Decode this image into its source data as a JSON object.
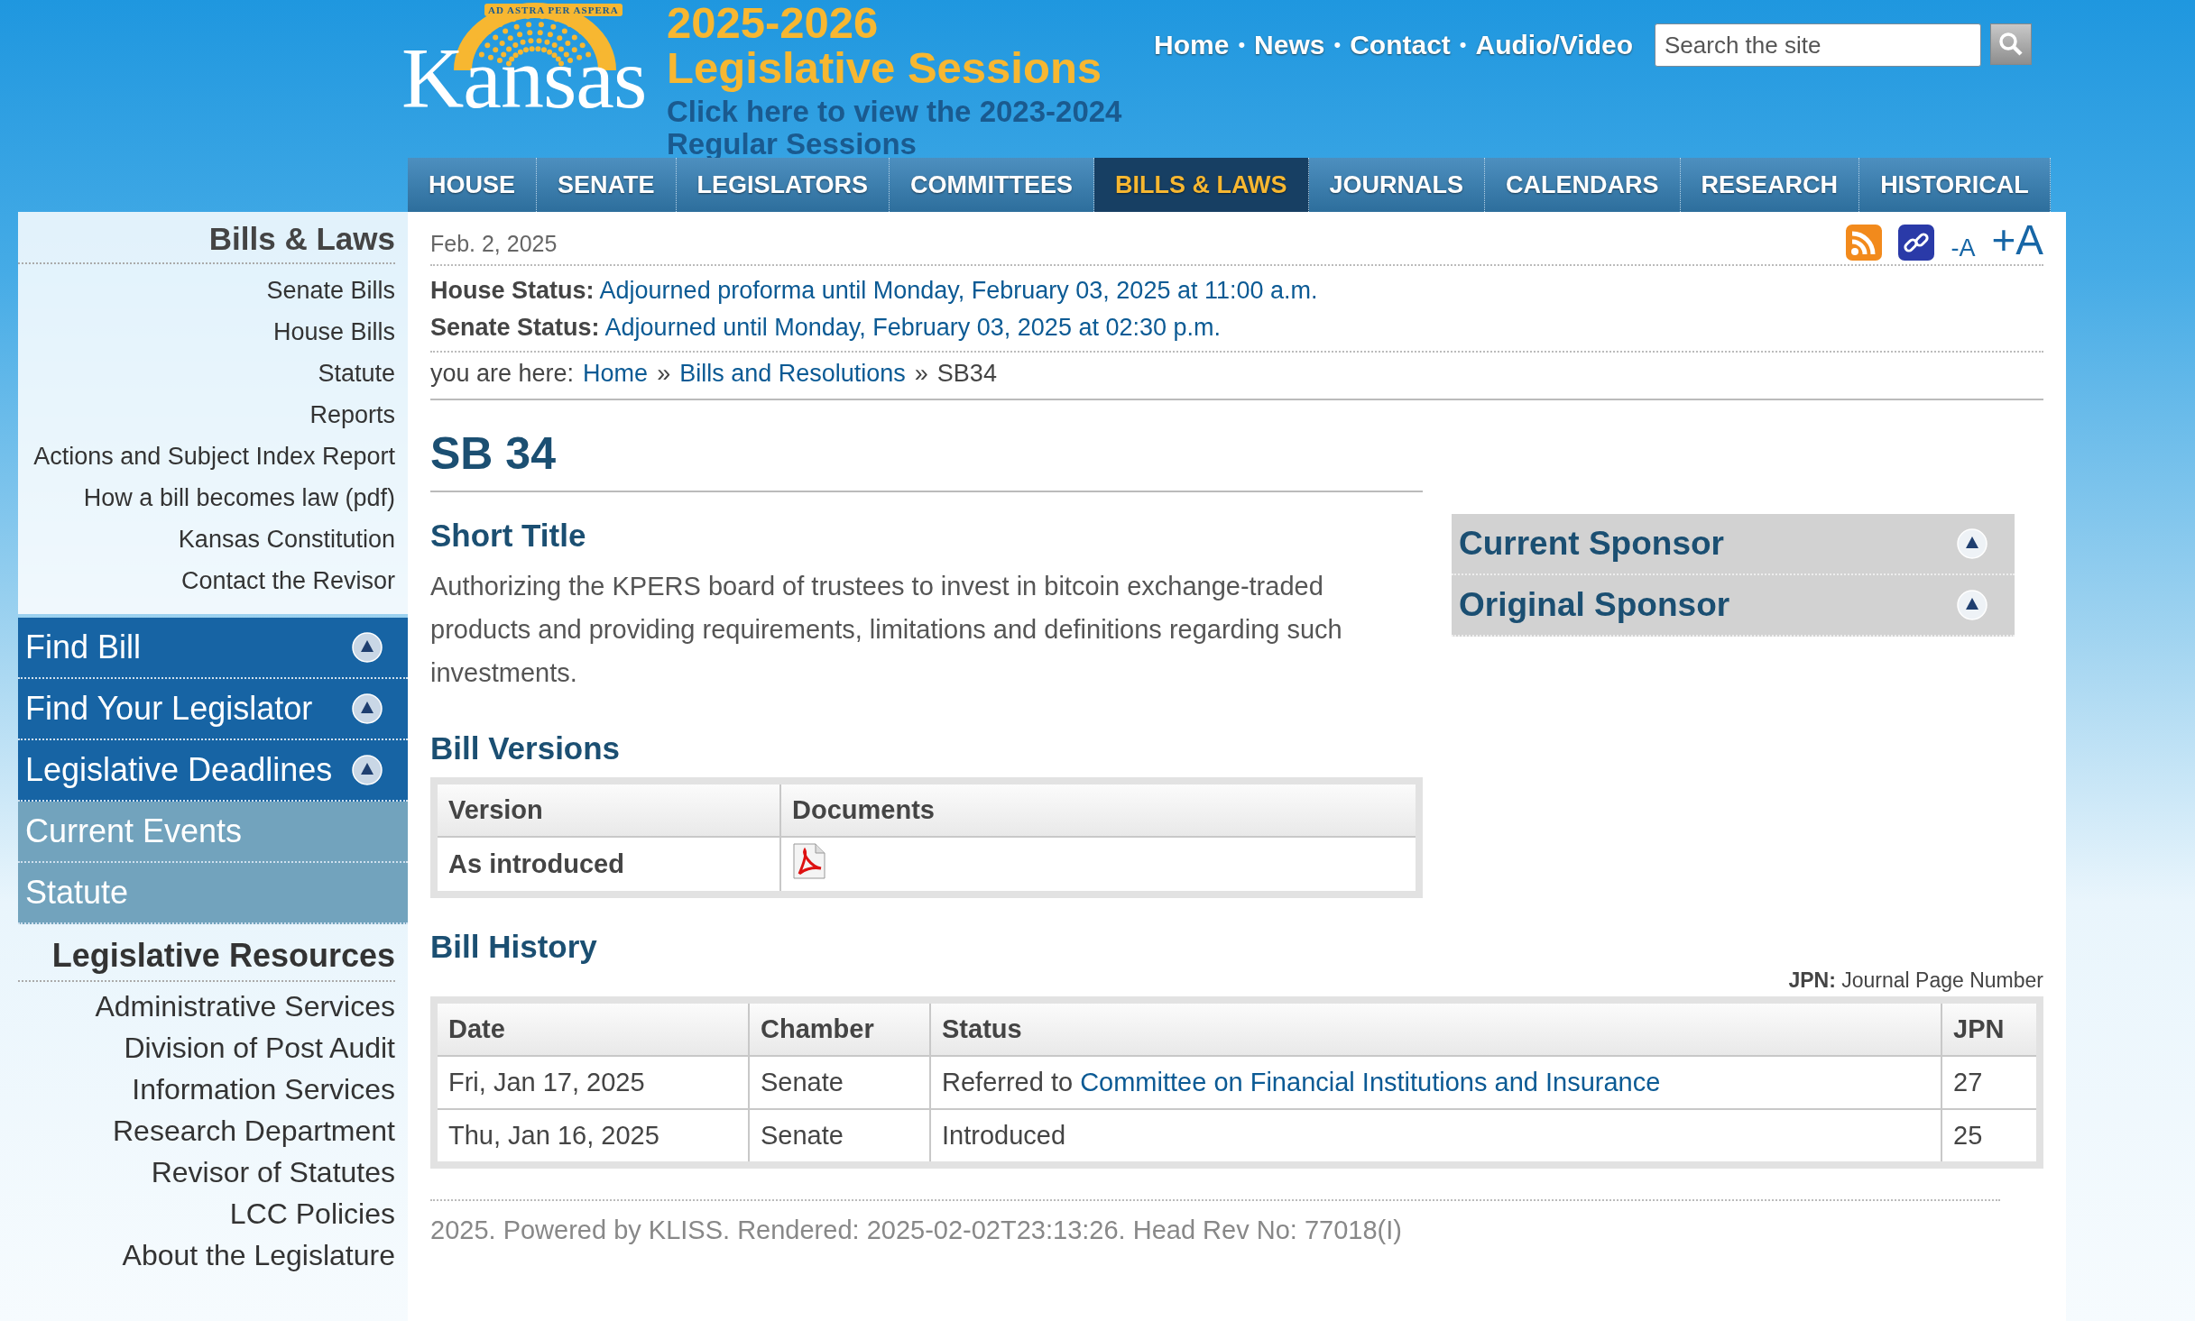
{
  "header": {
    "logo_text": "Kansas",
    "motto": "AD ASTRA PER ASPERA",
    "session_title": [
      "2025-2026",
      "Legislative Sessions"
    ],
    "session_link": "Click here to view the 2023-2024 Regular Sessions",
    "top_links": [
      "Home",
      "News",
      "Contact",
      "Audio/Video"
    ],
    "separator": "•",
    "search": {
      "placeholder": "Search the site"
    }
  },
  "nav": [
    {
      "label": "HOUSE",
      "selected": false
    },
    {
      "label": "SENATE",
      "selected": false
    },
    {
      "label": "LEGISLATORS",
      "selected": false
    },
    {
      "label": "COMMITTEES",
      "selected": false
    },
    {
      "label": "BILLS & LAWS",
      "selected": true
    },
    {
      "label": "JOURNALS",
      "selected": false
    },
    {
      "label": "CALENDARS",
      "selected": false
    },
    {
      "label": "RESEARCH",
      "selected": false
    },
    {
      "label": "HISTORICAL",
      "selected": false
    }
  ],
  "sidebar": {
    "title": "Bills & Laws",
    "links": [
      "Senate Bills",
      "House Bills",
      "Statute",
      "Reports",
      "Actions and Subject Index Report",
      "How a bill becomes law (pdf)",
      "Kansas Constitution",
      "Contact the Revisor"
    ],
    "panels": [
      {
        "label": "Find Bill",
        "kind": "toggle"
      },
      {
        "label": "Find Your Legislator",
        "kind": "toggle"
      },
      {
        "label": "Legislative Deadlines",
        "kind": "toggle"
      },
      {
        "label": "Current Events",
        "kind": "link"
      },
      {
        "label": "Statute",
        "kind": "link"
      }
    ],
    "resources_title": "Legislative Resources",
    "resources": [
      "Administrative Services",
      "Division of Post Audit",
      "Information Services",
      "Research Department",
      "Revisor of Statutes",
      "LCC Policies",
      "About the Legislature"
    ]
  },
  "main": {
    "date": "Feb. 2, 2025",
    "font_small": "-A",
    "font_large": "+A",
    "statuses": [
      {
        "label": "House Status:",
        "value": "Adjourned proforma until Monday, February 03, 2025 at 11:00 a.m."
      },
      {
        "label": "Senate Status:",
        "value": "Adjourned until Monday, February 03, 2025 at 02:30 p.m."
      }
    ],
    "breadcrumb": {
      "prefix": "you are here:",
      "separator": "»",
      "links": [
        "Home",
        "Bills and Resolutions"
      ],
      "current": "SB34"
    },
    "title": "SB 34",
    "short_title_heading": "Short Title",
    "short_title": "Authorizing the KPERS board of trustees to invest in bitcoin exchange-traded products and providing requirements, limitations and definitions regarding such investments.",
    "sponsors": [
      "Current Sponsor",
      "Original Sponsor"
    ],
    "versions": {
      "heading": "Bill Versions",
      "columns": [
        "Version",
        "Documents"
      ],
      "rows": [
        {
          "version": "As introduced"
        }
      ]
    },
    "history": {
      "heading": "Bill History",
      "legend_term": "JPN:",
      "legend_text": "Journal Page Number",
      "columns": [
        "Date",
        "Chamber",
        "Status",
        "JPN"
      ],
      "rows": [
        {
          "date": "Fri, Jan 17, 2025",
          "chamber": "Senate",
          "status": "Referred to",
          "status_link": "Committee on Financial Institutions and Insurance",
          "jpn": "27"
        },
        {
          "date": "Thu, Jan 16, 2025",
          "chamber": "Senate",
          "status": "Introduced",
          "jpn": "25"
        }
      ]
    }
  },
  "footer": "2025. Powered by KLISS. Rendered: 2025-02-02T23:13:26. Head Rev No: 77018(I)"
}
